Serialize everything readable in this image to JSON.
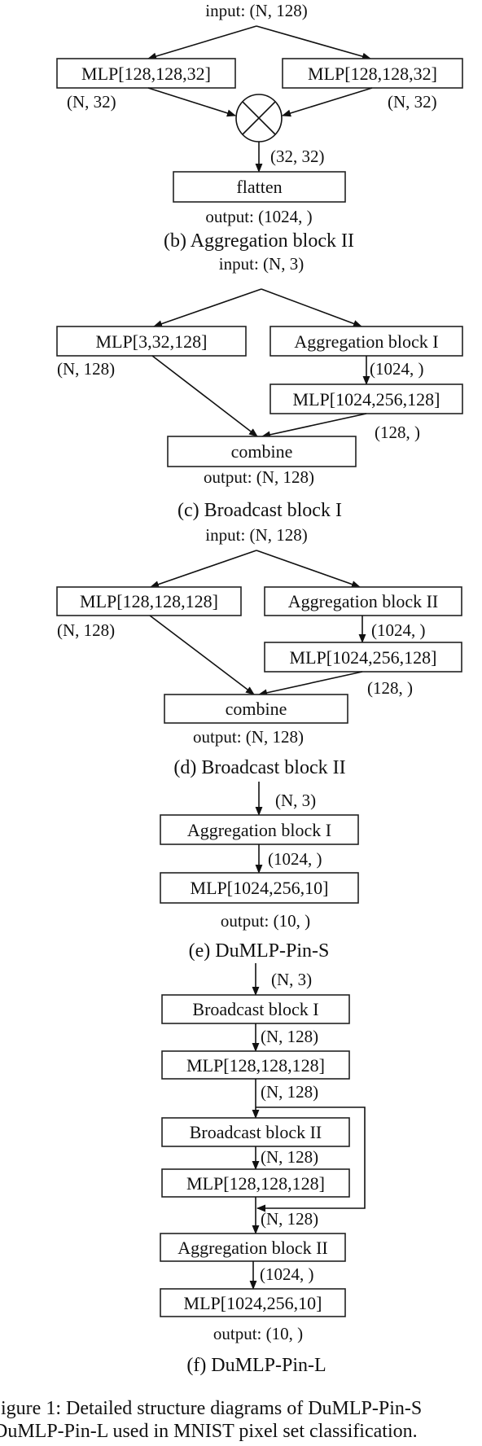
{
  "figure": {
    "caption_line1": "igure 1: Detailed structure diagrams of DuMLP-Pin-S",
    "caption_line2": "DuMLP-Pin-L used in MNIST pixel set classification."
  },
  "panel_b": {
    "input": "input: (N, 128)",
    "left_box": "MLP[128,128,32]",
    "right_box": "MLP[128,128,32]",
    "left_shape": "(N, 32)",
    "right_shape": "(N, 32)",
    "product_icon": "outer-product-icon",
    "product_shape": "(32, 32)",
    "flatten_box": "flatten",
    "output": "output: (1024, )",
    "title": "(b) Aggregation block II"
  },
  "panel_c": {
    "input": "input: (N, 3)",
    "left_box": "MLP[3,32,128]",
    "right_box": "Aggregation block I",
    "left_shape": "(N, 128)",
    "right_shape": "(1024, )",
    "right_box2": "MLP[1024,256,128]",
    "right_shape2": "(128, )",
    "combine_box": "combine",
    "output": "output: (N, 128)",
    "title": "(c) Broadcast block I"
  },
  "panel_d": {
    "input": "input: (N, 128)",
    "left_box": "MLP[128,128,128]",
    "right_box": "Aggregation block II",
    "left_shape": "(N, 128)",
    "right_shape": "(1024, )",
    "right_box2": "MLP[1024,256,128]",
    "right_shape2": "(128, )",
    "combine_box": "combine",
    "output": "output: (N, 128)",
    "title": "(d) Broadcast block II"
  },
  "panel_e": {
    "input_shape": "(N, 3)",
    "box1": "Aggregation block I",
    "shape1": "(1024, )",
    "box2": "MLP[1024,256,10]",
    "output": "output: (10, )",
    "title": "(e) DuMLP-Pin-S"
  },
  "panel_f": {
    "input_shape": "(N, 3)",
    "box1": "Broadcast block I",
    "shape1": "(N, 128)",
    "box2": "MLP[128,128,128]",
    "shape2": "(N, 128)",
    "box3": "Broadcast block II",
    "shape3": "(N, 128)",
    "box4": "MLP[128,128,128]",
    "shape4": "(N, 128)",
    "box5": "Aggregation block II",
    "shape5": "(1024, )",
    "box6": "MLP[1024,256,10]",
    "output": "output: (10, )",
    "title": "(f) DuMLP-Pin-L"
  }
}
